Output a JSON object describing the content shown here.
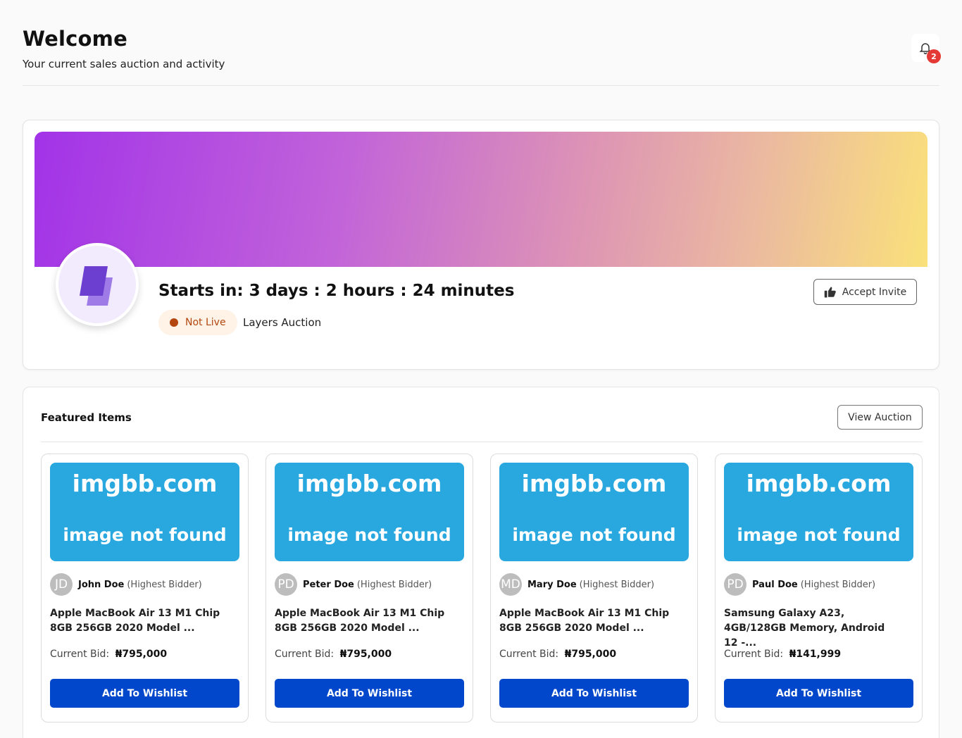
{
  "header": {
    "title": "Welcome",
    "subtitle": "Your current sales auction and activity",
    "notification_icon": "bell-icon",
    "notification_count": "2"
  },
  "auction": {
    "countdown": "Starts in: 3 days : 2 hours : 24 minutes",
    "status": "Not Live",
    "name": "Layers Auction",
    "accept_label": "Accept Invite",
    "accept_icon": "thumbs-up-icon",
    "banner_colors": [
      "#a233e8",
      "#c264d9",
      "#ebb9a0",
      "#fae17a"
    ],
    "status_color": "#b3470f"
  },
  "featured": {
    "title": "Featured Items",
    "view_label": "View Auction",
    "items": [
      {
        "image_line1": "imgbb.com",
        "image_line2": "image not found",
        "avatar": "JD",
        "bidder": "John Doe",
        "bidder_role": "(Highest Bidder)",
        "title": "Apple MacBook Air 13 M1 Chip 8GB 256GB 2020 Model ...",
        "bid_label": "Current Bid:",
        "bid_value": "₦795,000",
        "button_label": "Add To Wishlist"
      },
      {
        "image_line1": "imgbb.com",
        "image_line2": "image not found",
        "avatar": "PD",
        "bidder": "Peter Doe",
        "bidder_role": "(Highest Bidder)",
        "title": "Apple MacBook Air 13 M1 Chip 8GB 256GB 2020 Model ...",
        "bid_label": "Current Bid:",
        "bid_value": "₦795,000",
        "button_label": "Add To Wishlist"
      },
      {
        "image_line1": "imgbb.com",
        "image_line2": "image not found",
        "avatar": "MD",
        "bidder": "Mary Doe",
        "bidder_role": "(Highest Bidder)",
        "title": "Apple MacBook Air 13 M1 Chip 8GB 256GB 2020 Model ...",
        "bid_label": "Current Bid:",
        "bid_value": "₦795,000",
        "button_label": "Add To Wishlist"
      },
      {
        "image_line1": "imgbb.com",
        "image_line2": "image not found",
        "avatar": "PD",
        "bidder": "Paul Doe",
        "bidder_role": "(Highest Bidder)",
        "title": "Samsung Galaxy A23, 4GB/128GB Memory, Android 12 -...",
        "bid_label": "Current Bid:",
        "bid_value": "₦141,999",
        "button_label": "Add To Wishlist"
      }
    ]
  },
  "colors": {
    "primary_button": "#0047cc",
    "placeholder_image": "#29a8e0",
    "badge": "#e53935"
  }
}
